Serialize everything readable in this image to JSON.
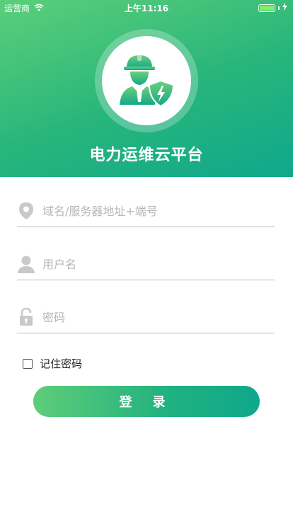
{
  "status_bar": {
    "carrier": "运营商",
    "time": "上午11:16",
    "battery_level": 1.0
  },
  "header": {
    "title": "电力运维云平台",
    "avatar_icon": "engineer-shield-icon",
    "gradient_start": "#5ccf7a",
    "gradient_end": "#0fa88c"
  },
  "form": {
    "server_field": {
      "placeholder": "域名/服务器地址+端号",
      "value": "",
      "icon": "location-pin-icon"
    },
    "username_field": {
      "placeholder": "用户名",
      "value": "",
      "icon": "user-icon"
    },
    "password_field": {
      "placeholder": "密码",
      "value": "",
      "icon": "lock-icon"
    },
    "remember_label": "记住密码",
    "remember_checked": false,
    "login_label": "登 录"
  }
}
